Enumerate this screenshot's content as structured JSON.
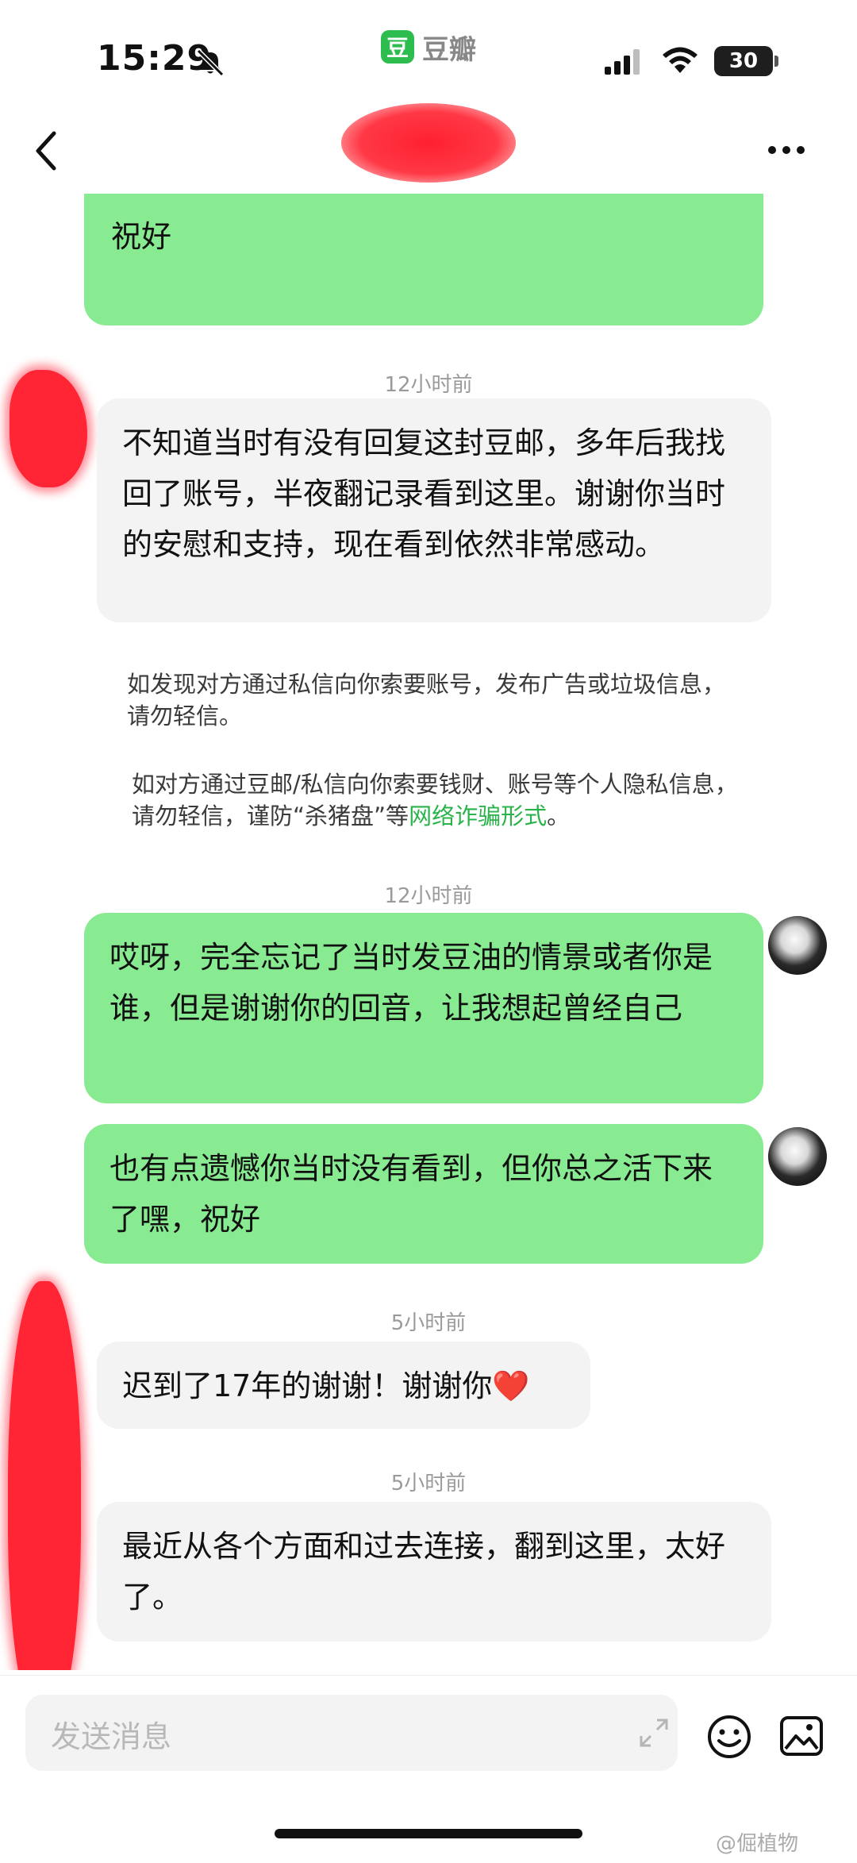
{
  "status_bar": {
    "time": "15:29",
    "battery": "30",
    "app_logo": "豆",
    "app_name": "豆瓣"
  },
  "icons": {
    "bell": "bell-slash-icon",
    "signal": "signal-icon",
    "wifi": "wifi-icon",
    "back": "chevron-left-icon",
    "more": "more-icon",
    "expand": "expand-icon",
    "emoji": "emoji-icon",
    "image": "image-icon"
  },
  "chat": {
    "msg_top": "祝好",
    "ts1": "12小时前",
    "msg_a": "不知道当时有没有回复这封豆邮，多年后我找回了账号，半夜翻记录看到这里。谢谢你当时的安慰和支持，现在看到依然非常感动。",
    "notice1": "如发现对方通过私信向你索要账号，发布广告或垃圾信息，请勿轻信。",
    "notice2_prefix": "如对方通过豆邮/私信向你索要钱财、账号等个人隐私信息，请勿轻信，谨防“杀猪盘”等",
    "notice2_link": "网络诈骗形式",
    "notice2_suffix": "。",
    "ts2": "12小时前",
    "msg_b": "哎呀，完全忘记了当时发豆油的情景或者你是谁，但是谢谢你的回音，让我想起曾经自己",
    "msg_c": "也有点遗憾你当时没有看到，但你总之活下来了嘿，祝好",
    "ts3": "5小时前",
    "msg_d": "迟到了17年的谢谢！谢谢你❤️",
    "ts4": "5小时前",
    "msg_e": "最近从各个方面和过去连接，翻到这里，太好了。"
  },
  "input": {
    "placeholder": "发送消息"
  },
  "watermark": "@倔植物",
  "colors": {
    "my_bubble": "#88ea91",
    "their_bubble": "#f3f3f3",
    "link": "#2bb34b"
  }
}
